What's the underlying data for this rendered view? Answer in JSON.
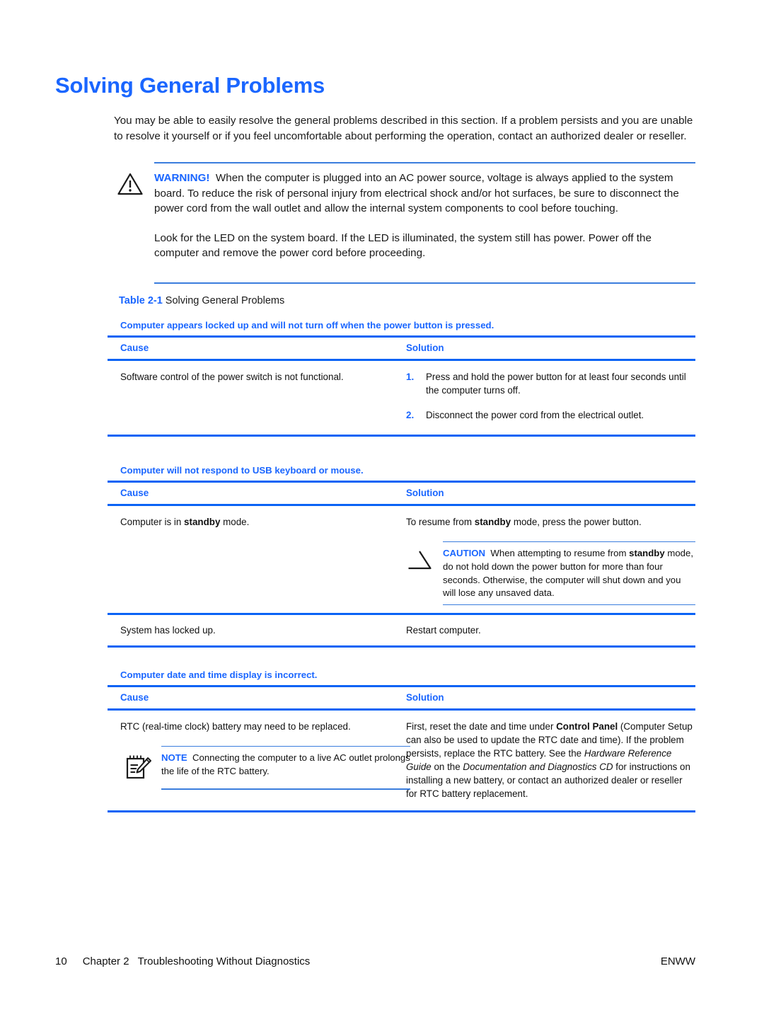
{
  "colors": {
    "heading_blue": "#1a66ff",
    "rule_blue": "#0a63f5",
    "thin_rule_blue": "#3b7ddd",
    "body_text": "#111111"
  },
  "page_title": "Solving General Problems",
  "intro_paragraph": "You may be able to easily resolve the general problems described in this section. If a problem persists and you are unable to resolve it yourself or if you feel uncomfortable about performing the operation, contact an authorized dealer or reseller.",
  "warning": {
    "icon": "warning-triangle-icon",
    "label": "WARNING!",
    "paragraph_1": "When the computer is plugged into an AC power source, voltage is always applied to the system board. To reduce the risk of personal injury from electrical shock and/or hot surfaces, be sure to disconnect the power cord from the wall outlet and allow the internal system components to cool before touching.",
    "paragraph_2": "Look for the LED on the system board. If the LED is illuminated, the system still has power. Power off the computer and remove the power cord before proceeding."
  },
  "table_caption": {
    "number": "Table 2-1",
    "text": "Solving General Problems"
  },
  "table": {
    "headers": {
      "cause": "Cause",
      "solution": "Solution"
    },
    "sections": [
      {
        "title": "Computer appears locked up and will not turn off when the power button is pressed.",
        "rows": [
          {
            "cause": "Software control of the power switch is not functional.",
            "solution_list": [
              {
                "marker": "1.",
                "text": "Press and hold the power button for at least four seconds until the computer turns off."
              },
              {
                "marker": "2.",
                "text": "Disconnect the power cord from the electrical outlet."
              }
            ]
          }
        ]
      },
      {
        "title": "Computer will not respond to USB keyboard or mouse.",
        "rows": [
          {
            "cause_prefix": "Computer is in ",
            "cause_bold": "standby",
            "cause_suffix": " mode.",
            "solution_prefix": "To resume from ",
            "solution_bold": "standby",
            "solution_suffix": " mode, press the power button.",
            "caution": {
              "icon": "caution-triangle-icon",
              "label": "CAUTION",
              "text_part_1": "When attempting to resume from ",
              "text_bold": "standby",
              "text_part_2": " mode, do not hold down the power button for more than four seconds. Otherwise, the computer will shut down and you will lose any unsaved data."
            }
          },
          {
            "cause": "System has locked up.",
            "solution": "Restart computer."
          }
        ]
      },
      {
        "title": "Computer date and time display is incorrect.",
        "rows": [
          {
            "cause": "RTC (real-time clock) battery may need to be replaced.",
            "note": {
              "icon": "note-pad-pencil-icon",
              "label": "NOTE",
              "text": "Connecting the computer to a live AC outlet prolongs the life of the RTC battery."
            },
            "solution_part_1": "First, reset the date and time under ",
            "solution_bold_1": "Control Panel",
            "solution_part_2": " (Computer Setup can also be used to update the RTC date and time). If the problem persists, replace the RTC battery. See the ",
            "solution_italic_1": "Hardware Reference Guide",
            "solution_part_3": " on the ",
            "solution_italic_2": "Documentation and Diagnostics CD",
            "solution_part_4": " for instructions on installing a new battery, or contact an authorized dealer or reseller for RTC battery replacement."
          }
        ]
      }
    ]
  },
  "footer": {
    "page_number": "10",
    "chapter": "Chapter 2",
    "chapter_title": "Troubleshooting Without Diagnostics",
    "locale": "ENWW"
  }
}
